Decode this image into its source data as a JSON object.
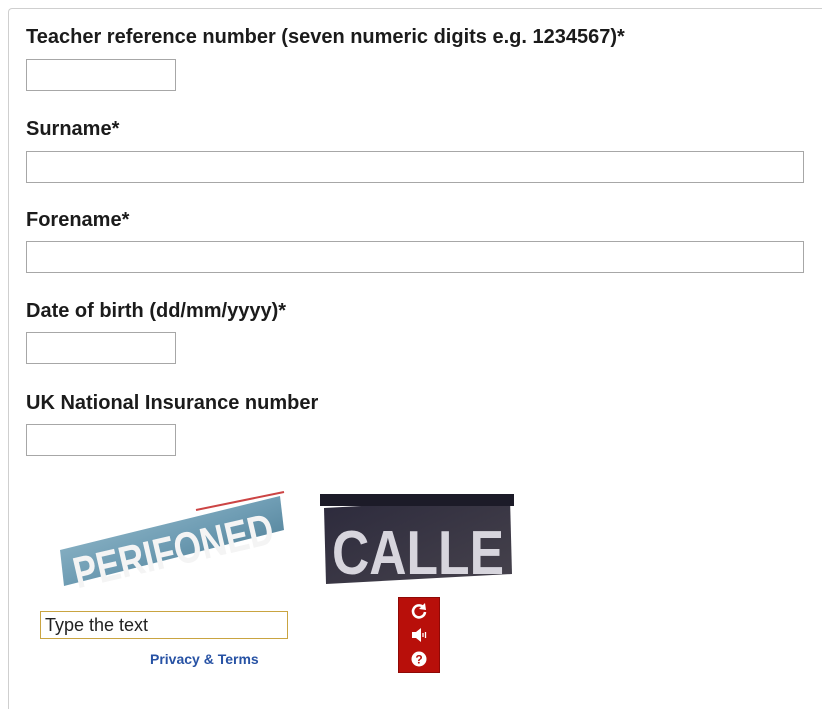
{
  "form": {
    "trn_label": "Teacher reference number (seven numeric digits e.g. 1234567)*",
    "trn_value": "",
    "surname_label": "Surname*",
    "surname_value": "",
    "forename_label": "Forename*",
    "forename_value": "",
    "dob_label": "Date of birth (dd/mm/yyyy)*",
    "dob_value": "",
    "ni_label": "UK National Insurance number",
    "ni_value": ""
  },
  "captcha": {
    "word_left": "PERIFONED",
    "word_right": "CALLE",
    "input_placeholder": "Type the text",
    "privacy_link": "Privacy & Terms",
    "controls": [
      "refresh-icon",
      "audio-icon",
      "help-icon"
    ],
    "panel_color": "#b80f0a"
  }
}
